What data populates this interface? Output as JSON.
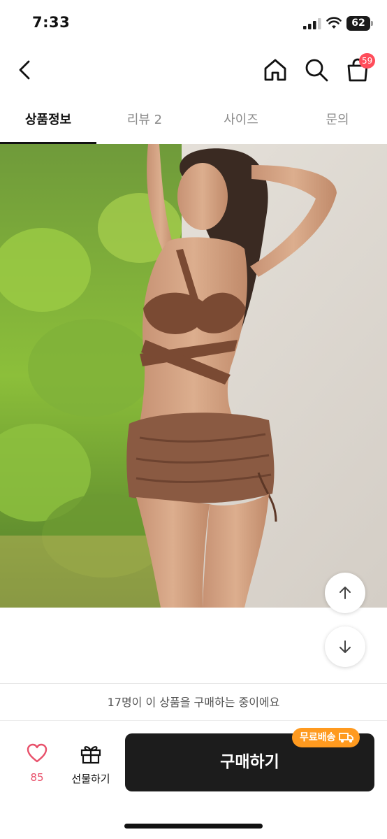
{
  "status": {
    "time": "7:33",
    "battery": "62"
  },
  "nav": {
    "cart_count": "59"
  },
  "tabs": [
    {
      "label": "상품정보",
      "active": true
    },
    {
      "label": "리뷰 2",
      "active": false
    },
    {
      "label": "사이즈",
      "active": false
    },
    {
      "label": "문의",
      "active": false
    }
  ],
  "activity": {
    "text": "17명이 이 상품을 구매하는 중이에요"
  },
  "actions": {
    "like_count": "85",
    "gift_label": "선물하기",
    "buy_label": "구매하기",
    "free_shipping_badge": "무료배송"
  },
  "colors": {
    "accent_pink": "#e8506a",
    "badge_red": "#ff4d5a",
    "badge_orange": "#ff9a1f",
    "buy_button": "#1c1c1c"
  },
  "icons": [
    "back-icon",
    "home-icon",
    "search-icon",
    "cart-icon",
    "arrow-up-icon",
    "arrow-down-icon",
    "heart-icon",
    "gift-icon",
    "truck-icon"
  ]
}
